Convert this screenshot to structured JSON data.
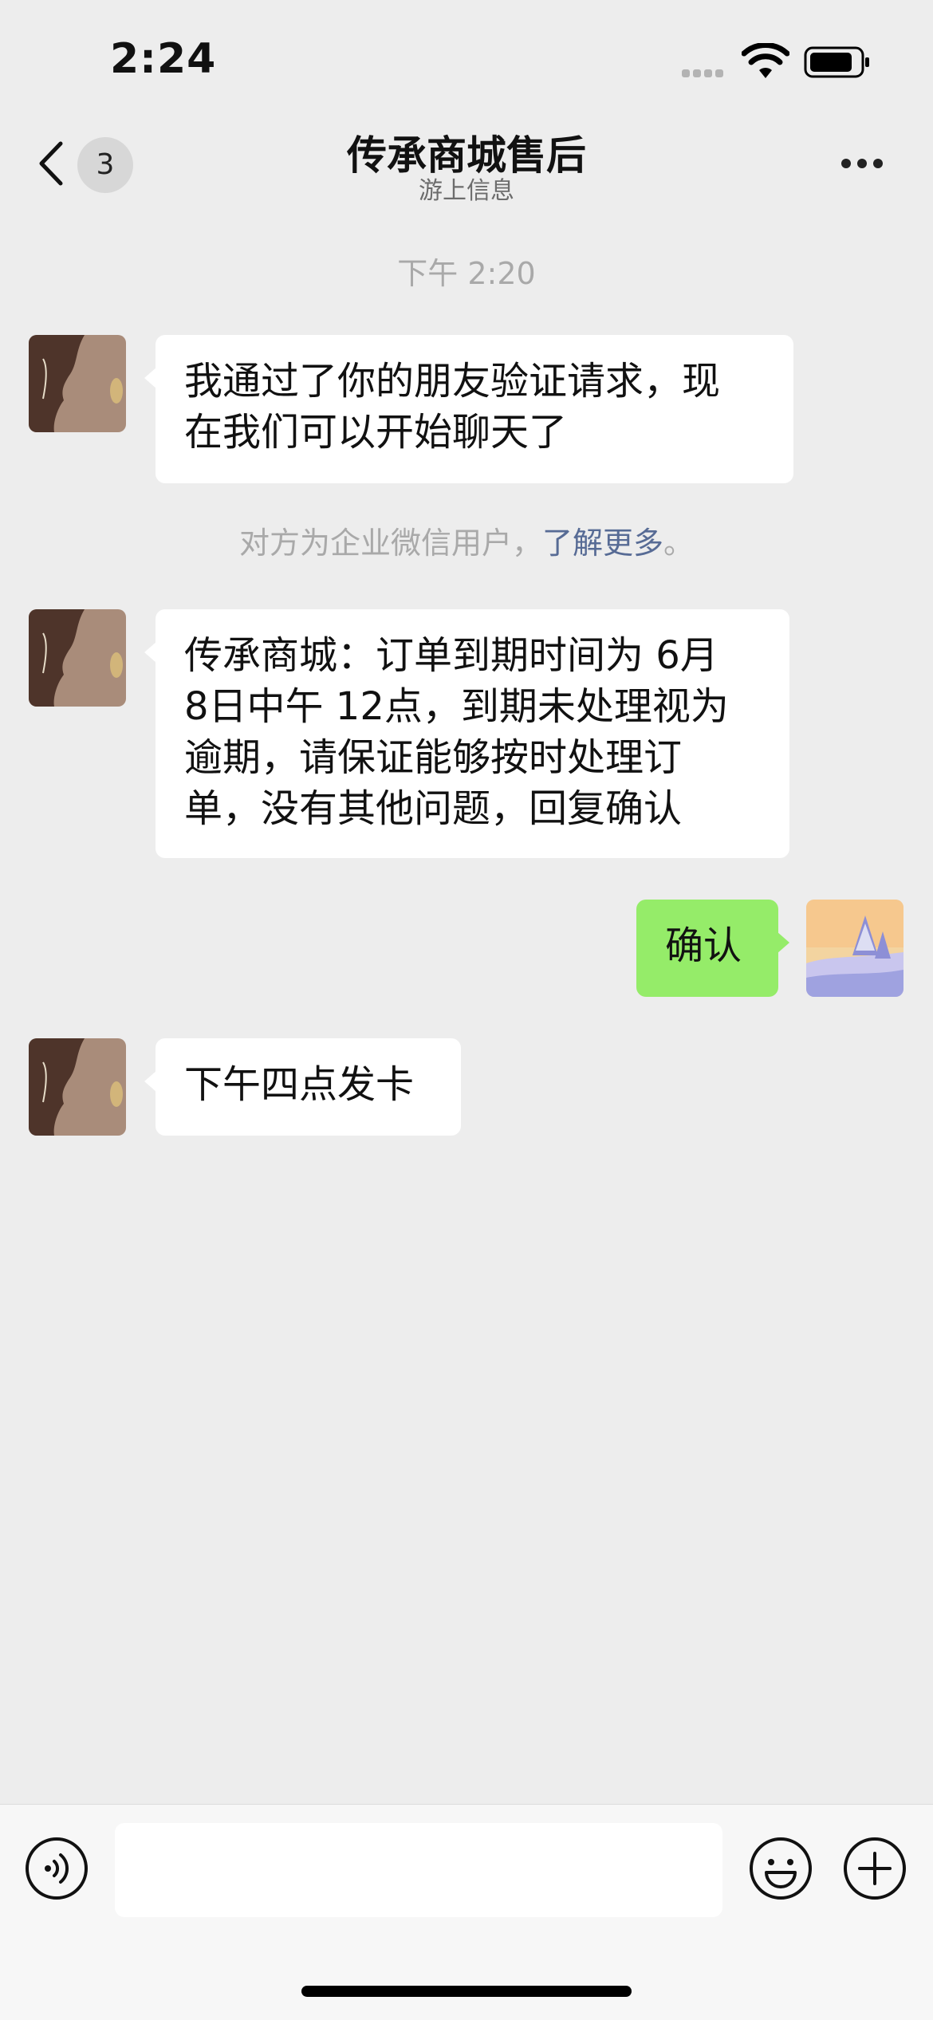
{
  "status_bar": {
    "time": "2:24"
  },
  "header": {
    "title": "传承商城售后",
    "subtitle": "游上信息",
    "unread_count": "3"
  },
  "messages": {
    "timestamp": "下午 2:20",
    "m1": {
      "line1": "我通过了你的朋友验证请求，现",
      "line2": "在我们可以开始聊天了"
    },
    "system_note": {
      "text": "对方为企业微信用户，",
      "link": "了解更多",
      "suffix": "。"
    },
    "m2": {
      "line1": "传承商城：订单到期时间为 6月",
      "line2": "8日中午 12点，到期未处理视为",
      "line3": "逾期，请保证能够按时处理订",
      "line4": "单，没有其他问题，回复确认"
    },
    "m3": {
      "text": "确认"
    },
    "m4": {
      "text": "下午四点发卡"
    }
  },
  "input": {
    "value": "",
    "placeholder": ""
  },
  "icons": {
    "back": "chevron-left-icon",
    "more": "more-dots-icon",
    "voice": "voice-icon",
    "emoji": "emoji-icon",
    "plus": "plus-icon"
  },
  "colors": {
    "background": "#ededed",
    "bubble_incoming": "#ffffff",
    "bubble_outgoing": "#95ec69",
    "link": "#576b95"
  }
}
